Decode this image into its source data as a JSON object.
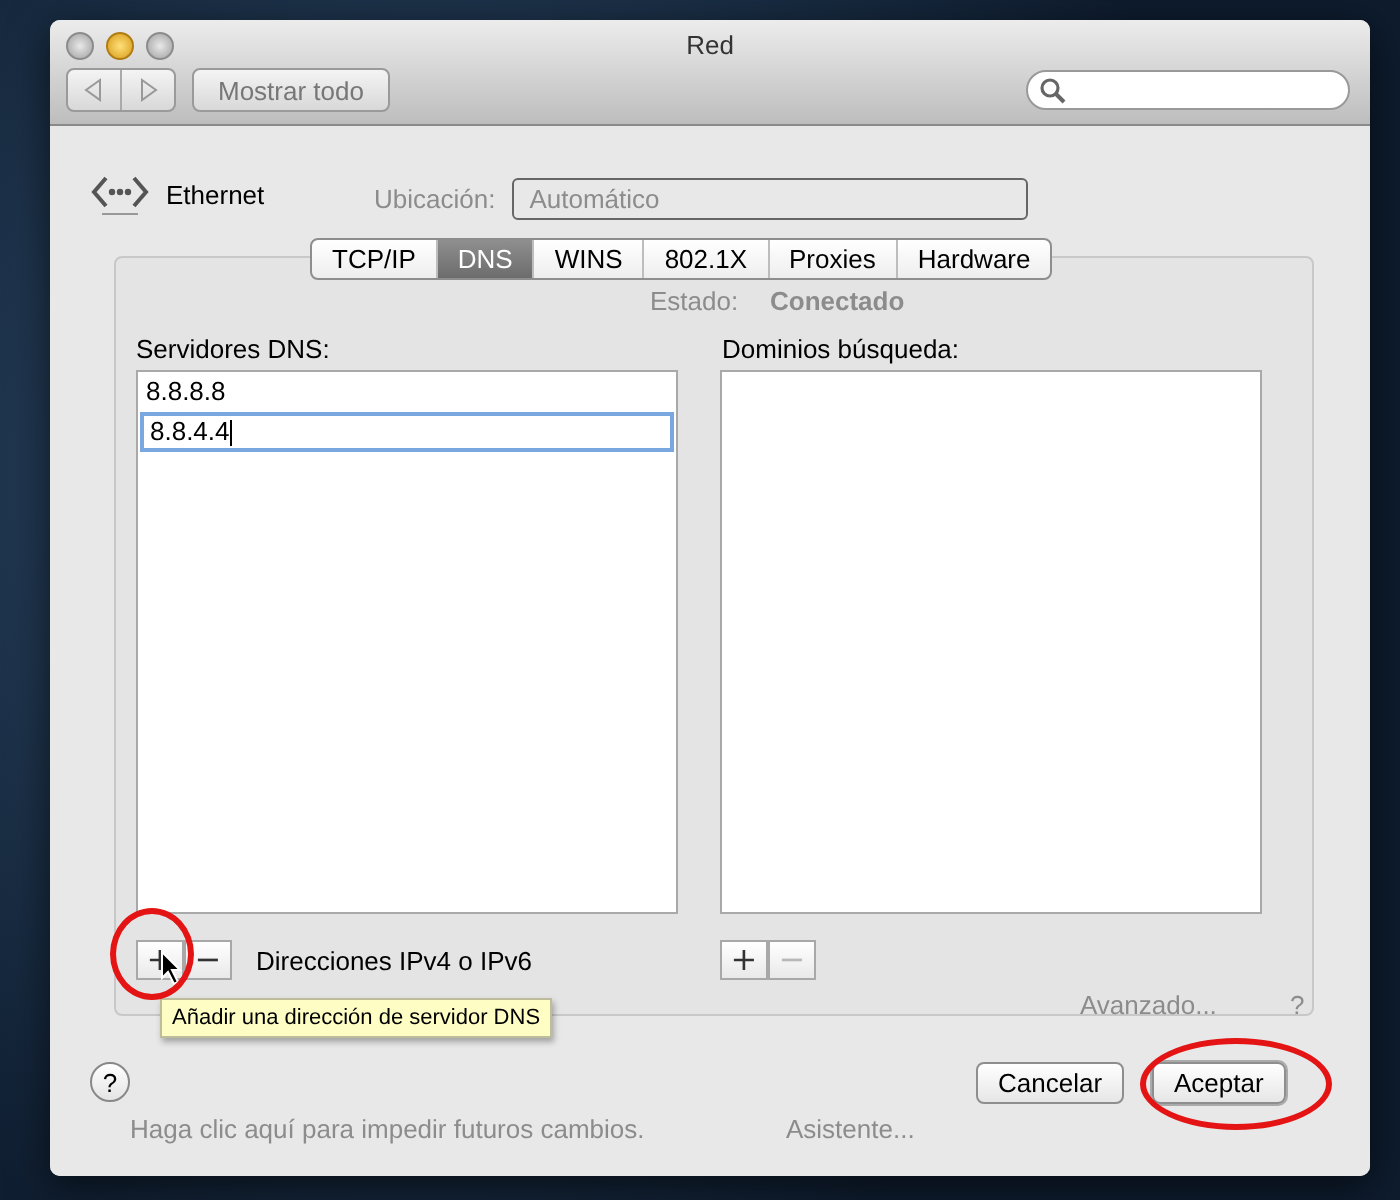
{
  "window": {
    "title": "Red"
  },
  "toolbar": {
    "show_all_button": "Mostrar todo"
  },
  "service": {
    "name": "Ethernet"
  },
  "location": {
    "label": "Ubicación:",
    "value": "Automático"
  },
  "tabs": [
    {
      "label": "TCP/IP",
      "selected": false
    },
    {
      "label": "DNS",
      "selected": true
    },
    {
      "label": "WINS",
      "selected": false
    },
    {
      "label": "802.1X",
      "selected": false
    },
    {
      "label": "Proxies",
      "selected": false
    },
    {
      "label": "Hardware",
      "selected": false
    }
  ],
  "status": {
    "label": "Estado:",
    "value": "Conectado"
  },
  "dns_servers": {
    "label": "Servidores DNS:",
    "entries": [
      {
        "value": "8.8.8.8",
        "editing": false
      },
      {
        "value": "8.8.4.4",
        "editing": true
      }
    ],
    "add": {
      "label": "+",
      "disabled": false
    },
    "remove": {
      "label": "−",
      "disabled": false
    },
    "hint": "Direcciones IPv4 o IPv6"
  },
  "search_domains": {
    "label": "Dominios búsqueda:",
    "add": {
      "label": "+",
      "disabled": false
    },
    "remove": {
      "label": "−",
      "disabled": true
    }
  },
  "tooltip": "Añadir una dirección de servidor DNS",
  "background": {
    "advanced_button": "Avanzado...",
    "help_button": "?",
    "lock_text": "Haga clic aquí para impedir futuros cambios.",
    "assistant_button": "Asistente..."
  },
  "help_button": "?",
  "buttons": [
    {
      "label": "Cancelar",
      "highlighted": false
    },
    {
      "label": "Aceptar",
      "highlighted": true
    }
  ]
}
